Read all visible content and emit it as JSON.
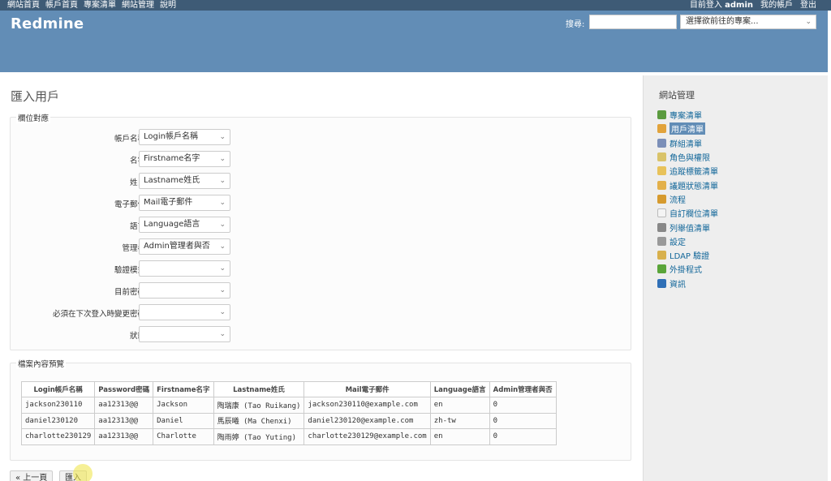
{
  "top_menu": {
    "left": [
      "網站首頁",
      "帳戶首頁",
      "專案清單",
      "網站管理",
      "說明"
    ],
    "logged_in_prefix": "目前登入",
    "user": "admin",
    "my_account": "我的帳戶",
    "logout": "登出"
  },
  "header": {
    "title": "Redmine",
    "search_label": "搜尋:",
    "search_value": "",
    "project_select": "選擇欲前往的專案..."
  },
  "page": {
    "title": "匯入用戶",
    "mapping_legend": "欄位對應",
    "preview_legend": "檔案內容預覽",
    "fields": [
      {
        "label": "帳戶名稱",
        "value": "Login帳戶名稱"
      },
      {
        "label": "名字",
        "value": "Firstname名字"
      },
      {
        "label": "姓氏",
        "value": "Lastname姓氏"
      },
      {
        "label": "電子郵件",
        "value": "Mail電子郵件"
      },
      {
        "label": "語言",
        "value": "Language語言"
      },
      {
        "label": "管理者",
        "value": "Admin管理者與否"
      },
      {
        "label": "驗證模式",
        "value": ""
      },
      {
        "label": "目前密碼",
        "value": ""
      },
      {
        "label": "必須在下次登入時變更密碼",
        "value": ""
      },
      {
        "label": "狀態",
        "value": ""
      }
    ],
    "preview": {
      "headers": [
        "Login帳戶名稱",
        "Password密碼",
        "Firstname名字",
        "Lastname姓氏",
        "Mail電子郵件",
        "Language語言",
        "Admin管理者與否"
      ],
      "rows": [
        [
          "jackson230110",
          "aa12313@@",
          "Jackson",
          "陶瑞康 (Tao Ruikang)",
          "jackson230110@example.com",
          "en",
          "0"
        ],
        [
          "daniel230120",
          "aa12313@@",
          "Daniel",
          "馬辰曦 (Ma Chenxi)",
          "daniel230120@example.com",
          "zh-tw",
          "0"
        ],
        [
          "charlotte230129",
          "aa12313@@",
          "Charlotte",
          "陶雨婷 (Tao Yuting)",
          "charlotte230129@example.com",
          "en",
          "0"
        ]
      ]
    },
    "back_button": "« 上一頁",
    "import_button": "匯入"
  },
  "sidebar": {
    "title": "網站管理",
    "items": [
      {
        "label": "專案清單",
        "icon": "projects-icon",
        "color": "#5b9b3f"
      },
      {
        "label": "用戶清單",
        "icon": "user-icon",
        "color": "#e2a33b",
        "selected": true
      },
      {
        "label": "群組清單",
        "icon": "group-icon",
        "color": "#7b8fb8"
      },
      {
        "label": "角色與權限",
        "icon": "roles-icon",
        "color": "#d9c36a"
      },
      {
        "label": "追蹤標籤清單",
        "icon": "tracker-icon",
        "color": "#e8c25a"
      },
      {
        "label": "議題狀態清單",
        "icon": "issue-status-icon",
        "color": "#e3b04a"
      },
      {
        "label": "流程",
        "icon": "workflow-icon",
        "color": "#d69a2e"
      },
      {
        "label": "自訂欄位清單",
        "icon": "custom-fields-icon",
        "color": "#f4f4f4"
      },
      {
        "label": "列舉值清單",
        "icon": "list-icon",
        "color": "#888888"
      },
      {
        "label": "設定",
        "icon": "settings-icon",
        "color": "#999999"
      },
      {
        "label": "LDAP 驗證",
        "icon": "ldap-icon",
        "color": "#d8b04c"
      },
      {
        "label": "外掛程式",
        "icon": "plugin-icon",
        "color": "#5aa53a"
      },
      {
        "label": "資訊",
        "icon": "info-icon",
        "color": "#2f6fb6"
      }
    ]
  }
}
